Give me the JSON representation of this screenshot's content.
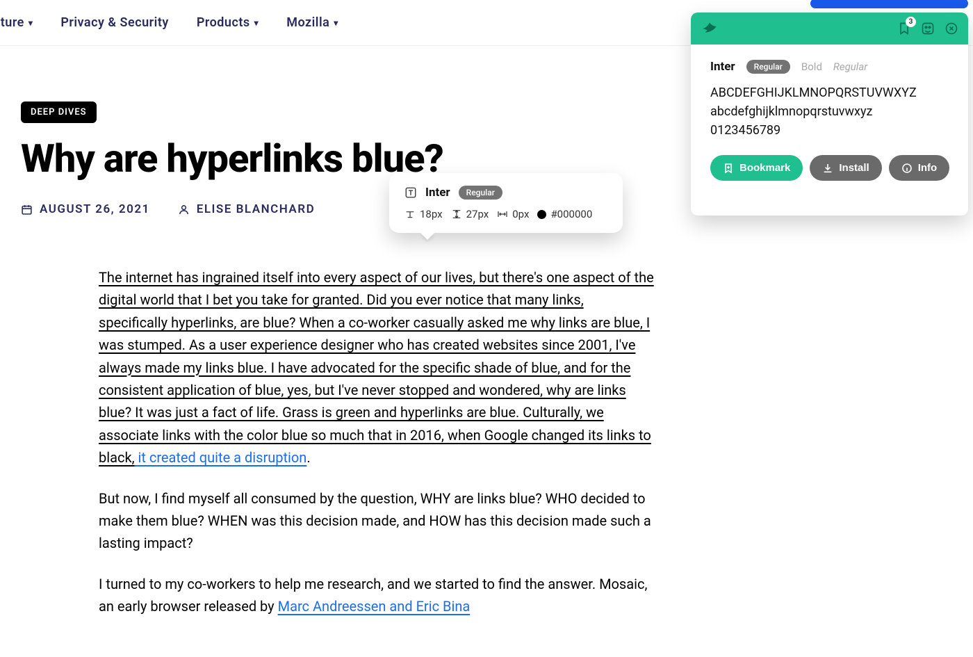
{
  "nav": {
    "items": [
      {
        "label": "ulture",
        "has_chevron": true
      },
      {
        "label": "Privacy & Security",
        "has_chevron": false
      },
      {
        "label": "Products",
        "has_chevron": true
      },
      {
        "label": "Mozilla",
        "has_chevron": true
      }
    ]
  },
  "article": {
    "category": "DEEP DIVES",
    "title": "Why are hyperlinks blue?",
    "date": "AUGUST 26, 2021",
    "author": "ELISE BLANCHARD",
    "p1_part1": "The internet has ingrained itself into every aspect of our lives, but there's one aspect of the digital world that I bet you take for granted. Did you ever notice that many links, specifically hyperlinks, are blue? When a co-worker casually asked me why links are blue, I was stumped. As a user experience designer who has created websites since 2001, I've always made my links blue. I have advocated for the specific shade of blue, and for the consistent application of blue, yes, but I've never stopped and wondered, why are links blue? It was just a fact of life. Grass is green and hyperlinks are blue. Culturally, we associate links with the color blue so much that in 2016, when Google changed its links to black,",
    "p1_link": " it created quite a disruption",
    "p1_part2": ".",
    "p2": "But now, I find myself all consumed by the question, WHY are links blue? WHO decided to make them blue? WHEN was this decision made, and HOW has this decision made such a lasting impact?",
    "p3_part1": "I turned to my co-workers to help me research, and we started to find the answer. Mosaic, an early browser released by ",
    "p3_link": "Marc Andreessen and Eric Bina"
  },
  "tooltip": {
    "font_name": "Inter",
    "weight_label": "Regular",
    "size": "18px",
    "line_height": "27px",
    "letter_spacing": "0px",
    "color": "#000000"
  },
  "extension": {
    "bookmark_count": "3",
    "font_name": "Inter",
    "weights": {
      "active": "Regular",
      "second": "Bold",
      "third": "Regular"
    },
    "specimen": {
      "upper": "ABCDEFGHIJKLMNOPQRSTUVWXYZ",
      "lower": "abcdefghijklmnopqrstuvwxyz",
      "digits": "0123456789"
    },
    "buttons": {
      "bookmark": "Bookmark",
      "install": "Install",
      "info": "Info"
    }
  }
}
